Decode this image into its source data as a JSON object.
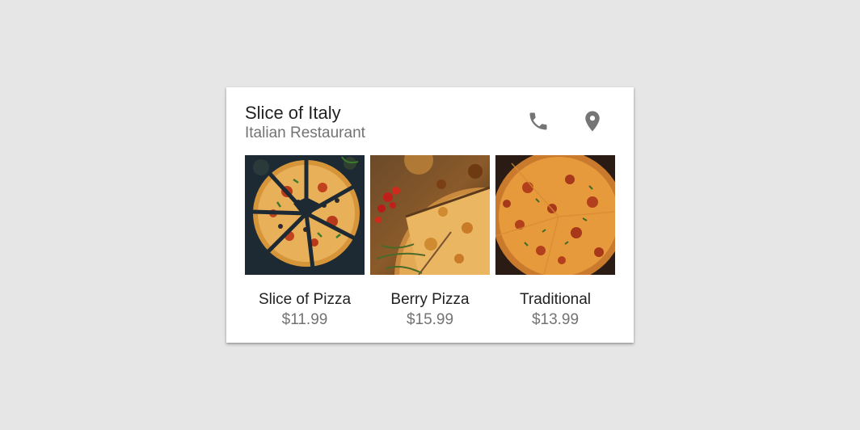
{
  "restaurant": {
    "name": "Slice of Italy",
    "category": "Italian Restaurant"
  },
  "actions": {
    "phone_icon": "phone-icon",
    "location_icon": "location-pin-icon",
    "icon_color": "#757575"
  },
  "menu_items": [
    {
      "name": "Slice of Pizza",
      "price": "$11.99",
      "image": "pizza-slices-dark-photo"
    },
    {
      "name": "Berry Pizza",
      "price": "$15.99",
      "image": "pizza-tomatoes-photo"
    },
    {
      "name": "Traditional",
      "price": "$13.99",
      "image": "pepperoni-pizza-photo"
    }
  ],
  "colors": {
    "background": "#e6e6e6",
    "card": "#ffffff",
    "primary_text": "#222222",
    "secondary_text": "#737373"
  }
}
